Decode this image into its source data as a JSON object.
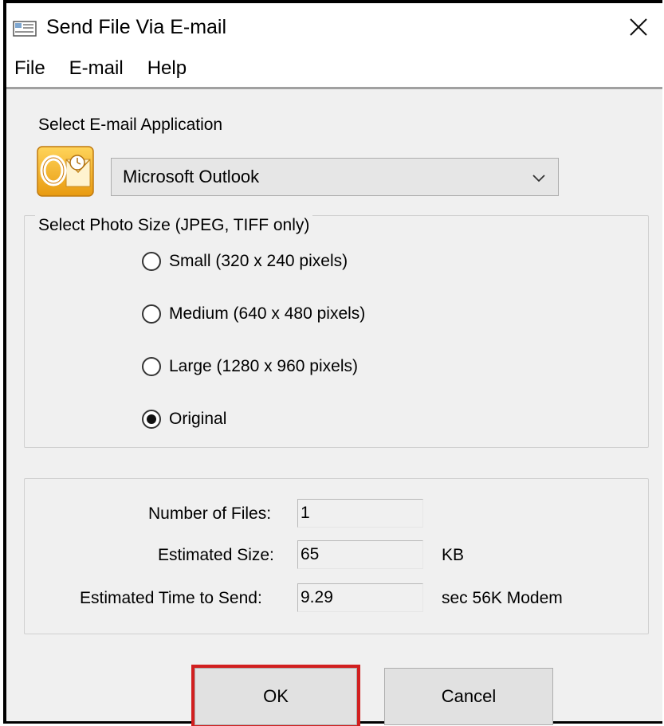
{
  "window": {
    "title": "Send File Via E-mail",
    "close_glyph": "✕"
  },
  "menu": {
    "items": [
      "File",
      "E-mail",
      "Help"
    ]
  },
  "email_app": {
    "label": "Select E-mail Application",
    "selected": "Microsoft Outlook",
    "icon": "outlook-logo"
  },
  "photo_size": {
    "legend": "Select Photo Size (JPEG, TIFF only)",
    "options": [
      {
        "label": "Small (320 x 240 pixels)",
        "checked": false
      },
      {
        "label": "Medium (640 x 480 pixels)",
        "checked": false
      },
      {
        "label": "Large (1280 x 960 pixels)",
        "checked": false
      },
      {
        "label": "Original",
        "checked": true
      }
    ]
  },
  "stats": {
    "files_label": "Number of Files:",
    "files_value": "1",
    "size_label": "Estimated Size:",
    "size_value": "65",
    "size_unit": "KB",
    "time_label": "Estimated Time to Send:",
    "time_value": "9.29",
    "time_unit": "sec 56K Modem"
  },
  "buttons": {
    "ok": "OK",
    "cancel": "Cancel"
  },
  "colors": {
    "highlight": "#d11f1f",
    "dialog_bg": "#f0f0f0",
    "outlook_orange": "#f0a020"
  }
}
